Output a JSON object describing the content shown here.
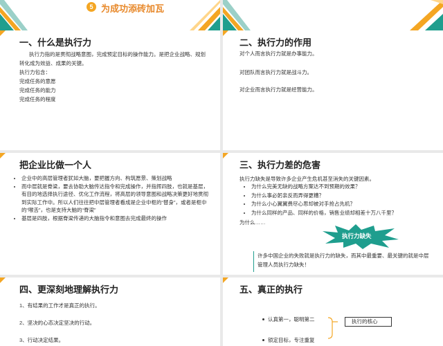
{
  "slide_top_left": {
    "number": "5",
    "title": "为成功添砖加瓦"
  },
  "slide1": {
    "title": "一、什么是执行力",
    "intro": "执行力指的是贯彻战略意图，完成预定目标的操作能力。是把企业战略、规划转化成为效益、成果的关键。",
    "include_label": "执行力包含：",
    "items": [
      "完成任务的意愿",
      "完成任务的能力",
      "完成任务的程度"
    ]
  },
  "slide2": {
    "title": "二、执行力的作用",
    "lines": [
      "对个人而言执行力就是办事能力。",
      "对团队而言执行力就是战斗力。",
      "对企业而言执行力就是经营能力。"
    ]
  },
  "slide3": {
    "title": "把企业比做一个人",
    "bullets": [
      "企业中的高层管理者犹如大脑，要把握方向、构筑愿景、策划战略",
      "而中层就是脊梁，要去协助大脑传达指令和完成操作，并指挥四肢，也就是基层，有目的地选择执行途径、优化工作流程，将高层的领导意图和战略决策更好地贯彻到实际工作中。所以人们往往把中层管理者看成是企业中枢的“替身”，或者是枢中的“喉舌”，也是支持大脑的“脊梁”",
      "基层是四肢，根据脊梁传递的大脑指令和意图去完成最终的操作"
    ]
  },
  "slide4": {
    "title": "三、执行力差的危害",
    "intro": "执行力缺失是导致许多企业产生危机甚至消失的关键因素。",
    "questions": [
      "为什么完美无缺的战略方案达不到预期的效果？",
      "为什么事必躬亲反而弄得更糟？",
      "为什么小心翼翼费尽心思却被对手抢占先机？",
      "为什么同样的产品、同样的价格，销售业绩却相差十万八千里？"
    ],
    "why": "为什么……",
    "burst_label": "执行力缺失",
    "conclusion": "许多中国企业的失败就是执行力的缺失，而其中最重要、最关键的就是中层管理人员执行力缺失！"
  },
  "slide5": {
    "title": "四、更深刻地理解执行力",
    "lines": [
      "1、有结果的工作才是真正的执行。",
      "2、坚决的心态决定坚决的行动。",
      "3、行动决定结果。"
    ]
  },
  "slide6": {
    "title": "五、真正的执行",
    "row1": "认真第一，聪明第二",
    "box_label": "执行的核心",
    "row2": "锁定目标，专注重复"
  },
  "colors": {
    "orange": "#f4a623",
    "teal": "#1f9e8e",
    "accent_orange": "#e8892b"
  }
}
